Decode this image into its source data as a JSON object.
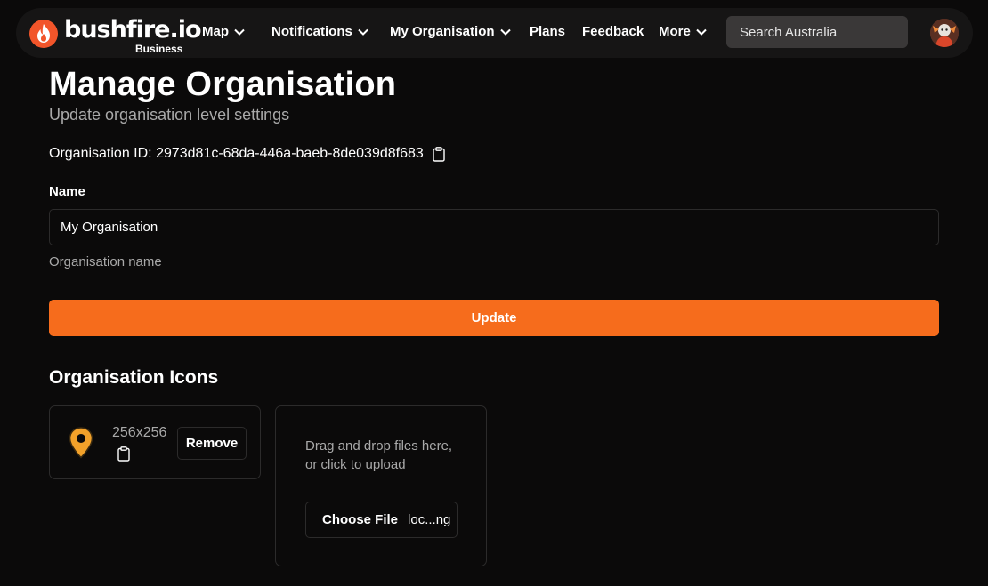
{
  "nav": {
    "logo_text": "bushfire.io",
    "logo_sub": "Business",
    "items": [
      {
        "label": "Map",
        "has_dropdown": true
      },
      {
        "label": "Notifications",
        "has_dropdown": true
      },
      {
        "label": "My Organisation",
        "has_dropdown": true
      },
      {
        "label": "Plans",
        "has_dropdown": false
      },
      {
        "label": "Feedback",
        "has_dropdown": false
      },
      {
        "label": "More",
        "has_dropdown": true
      }
    ],
    "search_placeholder": "Search Australia"
  },
  "page": {
    "title": "Manage Organisation",
    "subtitle": "Update organisation level settings",
    "org_id_label": "Organisation ID:",
    "org_id_value": "2973d81c-68da-446a-baeb-8de039d8f683"
  },
  "form": {
    "name_label": "Name",
    "name_value": "My Organisation",
    "name_help": "Organisation name",
    "update_label": "Update"
  },
  "icons": {
    "heading": "Organisation Icons",
    "card": {
      "dimensions": "256x256",
      "remove_label": "Remove"
    },
    "upload": {
      "drop_text": "Drag and drop files here, or click to upload",
      "choose_label": "Choose File",
      "file_name": "loc...ng"
    }
  },
  "colors": {
    "accent": "#f66c1c",
    "background": "#0b0a0a",
    "navbar": "#161515",
    "pin": "#f2a12a"
  }
}
